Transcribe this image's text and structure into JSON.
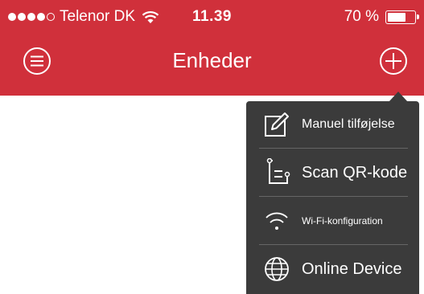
{
  "status_bar": {
    "carrier": "Telenor DK",
    "signal_bars_filled": 4,
    "signal_bars_total": 5,
    "time": "11.39",
    "battery_percent": "70 %",
    "battery_level": 0.7
  },
  "nav": {
    "title": "Enheder",
    "menu_icon": "hamburger-circle-icon",
    "add_icon": "plus-circle-icon"
  },
  "add_menu": {
    "items": [
      {
        "label": "Manuel tilføjelse",
        "icon": "edit-icon"
      },
      {
        "label": "Scan QR-kode",
        "icon": "qr-scan-icon"
      },
      {
        "label": "Wi-Fi-konfiguration",
        "icon": "wifi-icon"
      },
      {
        "label": "Online Device",
        "icon": "globe-icon"
      }
    ]
  },
  "colors": {
    "header": "#d0303b",
    "popover": "#3b3b3b",
    "divider": "#666666",
    "text_light": "#ffffff"
  }
}
